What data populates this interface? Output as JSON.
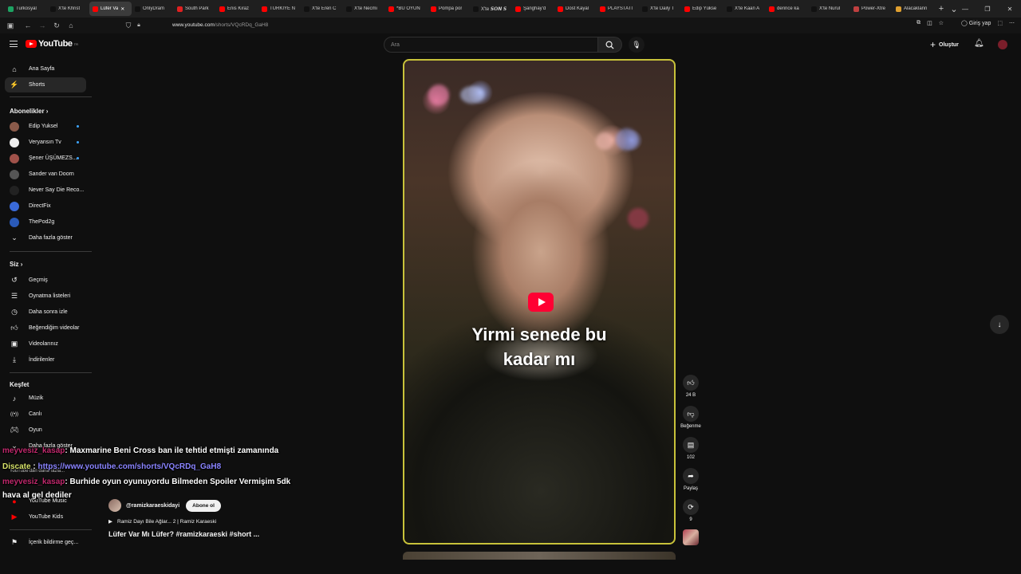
{
  "browser": {
    "tabs": [
      {
        "label": "Turkosyal",
        "color": "#1da362"
      },
      {
        "label": "X'te Khrist",
        "color": "#111111"
      },
      {
        "label": "Lüfer Va",
        "color": "#ff0000",
        "active": true
      },
      {
        "label": "OnlyDram",
        "color": "#111111"
      },
      {
        "label": "South Park",
        "color": "#e02020"
      },
      {
        "label": "Enis Kiraz",
        "color": "#ff0000"
      },
      {
        "label": "TÜRKİYE N",
        "color": "#ff0000"
      },
      {
        "label": "X'te Eren C",
        "color": "#111111"
      },
      {
        "label": "X'te Necmi",
        "color": "#111111"
      },
      {
        "label": "*BU OYUN",
        "color": "#ff0000"
      },
      {
        "label": "Pompa por",
        "color": "#ff0000"
      },
      {
        "label": "X'te 𝙎𝙊𝙉 𝙎",
        "color": "#111111"
      },
      {
        "label": "Şanghay'd",
        "color": "#ff0000"
      },
      {
        "label": "Dost Kayal",
        "color": "#ff0000"
      },
      {
        "label": "PLAYSTATI",
        "color": "#ff0000"
      },
      {
        "label": "X'te Daily T",
        "color": "#111111"
      },
      {
        "label": "Edip Yükse",
        "color": "#ff0000"
      },
      {
        "label": "X'te Kaan A",
        "color": "#111111"
      },
      {
        "label": "derince ka",
        "color": "#ff0000"
      },
      {
        "label": "X'te Nurul",
        "color": "#111111"
      },
      {
        "label": "Power-Xtre",
        "color": "#c04040"
      },
      {
        "label": "Alacaklann",
        "color": "#e0a030"
      }
    ],
    "new_tab": "+",
    "tab_menu": "⌄",
    "url_domain": "www.youtube.com",
    "url_path": "/shorts/VQcRDq_GaH8",
    "sign_in": "Giriş yap"
  },
  "header": {
    "logo_text": "YouTube",
    "logo_sup": "TR",
    "search_placeholder": "Ara",
    "create_label": "Oluştur"
  },
  "sidebar": {
    "main": [
      {
        "label": "Ana Sayfa",
        "icon": "home-icon"
      },
      {
        "label": "Shorts",
        "icon": "shorts-icon"
      }
    ],
    "subs_title": "Abonelikler",
    "subs": [
      {
        "label": "Edip Yuksel",
        "color": "#8a5a4a"
      },
      {
        "label": "Veryansın Tv",
        "color": "#eeeeee"
      },
      {
        "label": "Şener ÜŞÜMEZS...",
        "color": "#a0524a"
      },
      {
        "label": "Sander van Doorn",
        "color": "#555555"
      },
      {
        "label": "Never Say Die Reco...",
        "color": "#222222"
      },
      {
        "label": "DirectFix",
        "color": "#3a6ad8"
      },
      {
        "label": "ThePod2g",
        "color": "#2a5ab8"
      }
    ],
    "show_more": "Daha fazla göster",
    "you_title": "Siz",
    "you": [
      {
        "label": "Geçmiş",
        "icon": "history-icon"
      },
      {
        "label": "Oynatma listeleri",
        "icon": "playlist-icon"
      },
      {
        "label": "Daha sonra izle",
        "icon": "clock-icon"
      },
      {
        "label": "Beğendiğim videolar",
        "icon": "like-icon"
      },
      {
        "label": "Videolarınız",
        "icon": "video-icon"
      },
      {
        "label": "İndirilenler",
        "icon": "download-icon"
      }
    ],
    "explore_title": "Keşfet",
    "explore": [
      {
        "label": "Müzik",
        "icon": "music-icon"
      },
      {
        "label": "Canlı",
        "icon": "live-icon"
      },
      {
        "label": "Oyun",
        "icon": "gaming-icon"
      }
    ],
    "explore_more": "Daha fazla göster",
    "more_from_yt": "YouTube'dan daha fazla...",
    "yt_music": "YouTube Music",
    "yt_kids": "YouTube Kids",
    "report": "İçerik bildirme geç..."
  },
  "short": {
    "caption_line1": "Yirmi senede bu",
    "caption_line2": "kadar mı"
  },
  "actions": {
    "like_count": "24 B",
    "dislike_label": "Beğenme",
    "comment_count": "102",
    "share_label": "Paylaş",
    "remix_count": "9"
  },
  "meta": {
    "handle": "@ramizkaraeskidayi",
    "subscribe": "Abone ol",
    "music": "Ramiz Dayı Bile Ağlar... 2 | Ramiz Karaeski",
    "title": "Lüfer Var Mı Lüfer? #ramizkaraeski #short ..."
  },
  "chat": [
    {
      "user": "meyvesiz_kasap",
      "text": ": Maxmarine Beni Cross ban ile tehtid etmişti zamanında"
    },
    {
      "user": "Discate",
      "text": " : ",
      "link": "https://www.youtube.com/shorts/VQcRDq_GaH8"
    },
    {
      "user": "meyvesiz_kasap",
      "text": ": Burhide oyun oyunuyordu Bilmeden Spoiler Vermişim 5dk"
    },
    {
      "user": "",
      "text": "hava al gel dediler"
    }
  ]
}
